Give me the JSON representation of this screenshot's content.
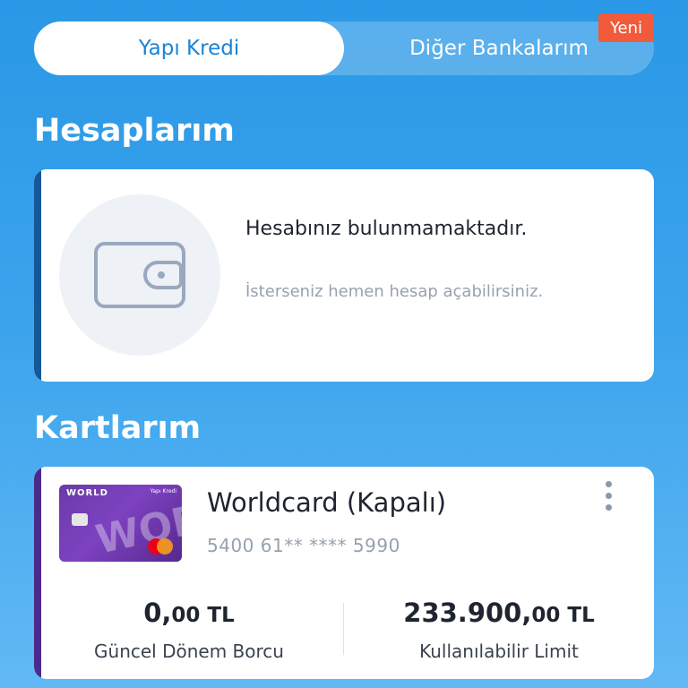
{
  "tabs": {
    "left_label": "Yapı Kredi",
    "right_label": "Diğer Bankalarım",
    "badge": "Yeni"
  },
  "accounts": {
    "title": "Hesaplarım",
    "empty_title": "Hesabınız bulunmamaktadır.",
    "empty_subtitle": "İsterseniz hemen hesap açabilirsiniz.",
    "icon": "wallet-icon"
  },
  "cards": {
    "title": "Kartlarım",
    "items": [
      {
        "image_brand": "WORLD",
        "image_bank": "Yapı Kredi",
        "image_big_text": "WORLD",
        "name": "Worldcard (Kapalı)",
        "number": "5400 61** **** 5990",
        "current_debt_main": "0,",
        "current_debt_small": "00 TL",
        "current_debt_label": "Güncel Dönem Borcu",
        "limit_main": "233.900,",
        "limit_small": "00 TL",
        "limit_label": "Kullanılabilir Limit"
      }
    ]
  },
  "colors": {
    "accent": "#1a84d6",
    "badge": "#f15a3b",
    "account_stripe": "#16579a",
    "card_stripe": "#4a2a8c"
  }
}
